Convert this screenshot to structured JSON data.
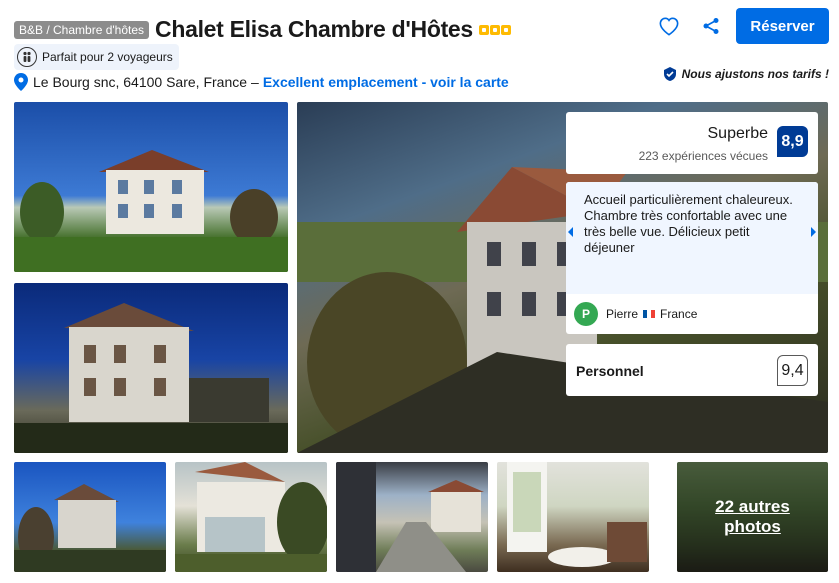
{
  "header": {
    "type_badge": "B&B / Chambre d'hôtes",
    "title": "Chalet Elisa Chambre d'Hôtes",
    "stars": 3,
    "travellers": "Parfait pour 2 voyageurs",
    "address": "Le Bourg snc, 64100 Sare, France",
    "dash": "–",
    "map_link": "Excellent emplacement - voir la carte",
    "reserve_label": "Réserver",
    "price_match": "Nous ajustons nos tarifs !"
  },
  "rating": {
    "word": "Superbe",
    "count": "223 expériences vécues",
    "score": "8,9"
  },
  "review": {
    "text": "Accueil particulièrement chaleureux. Chambre très confortable avec une très belle vue. Délicieux petit déjeuner",
    "reviewer_initial": "P",
    "reviewer_name": "Pierre",
    "reviewer_country": "France"
  },
  "staff": {
    "label": "Personnel",
    "score": "9,4"
  },
  "gallery": {
    "more_photos": "22 autres photos"
  },
  "colors": {
    "brand_blue": "#006ce4",
    "score_navy": "#003b95",
    "star_yellow": "#febb02"
  }
}
